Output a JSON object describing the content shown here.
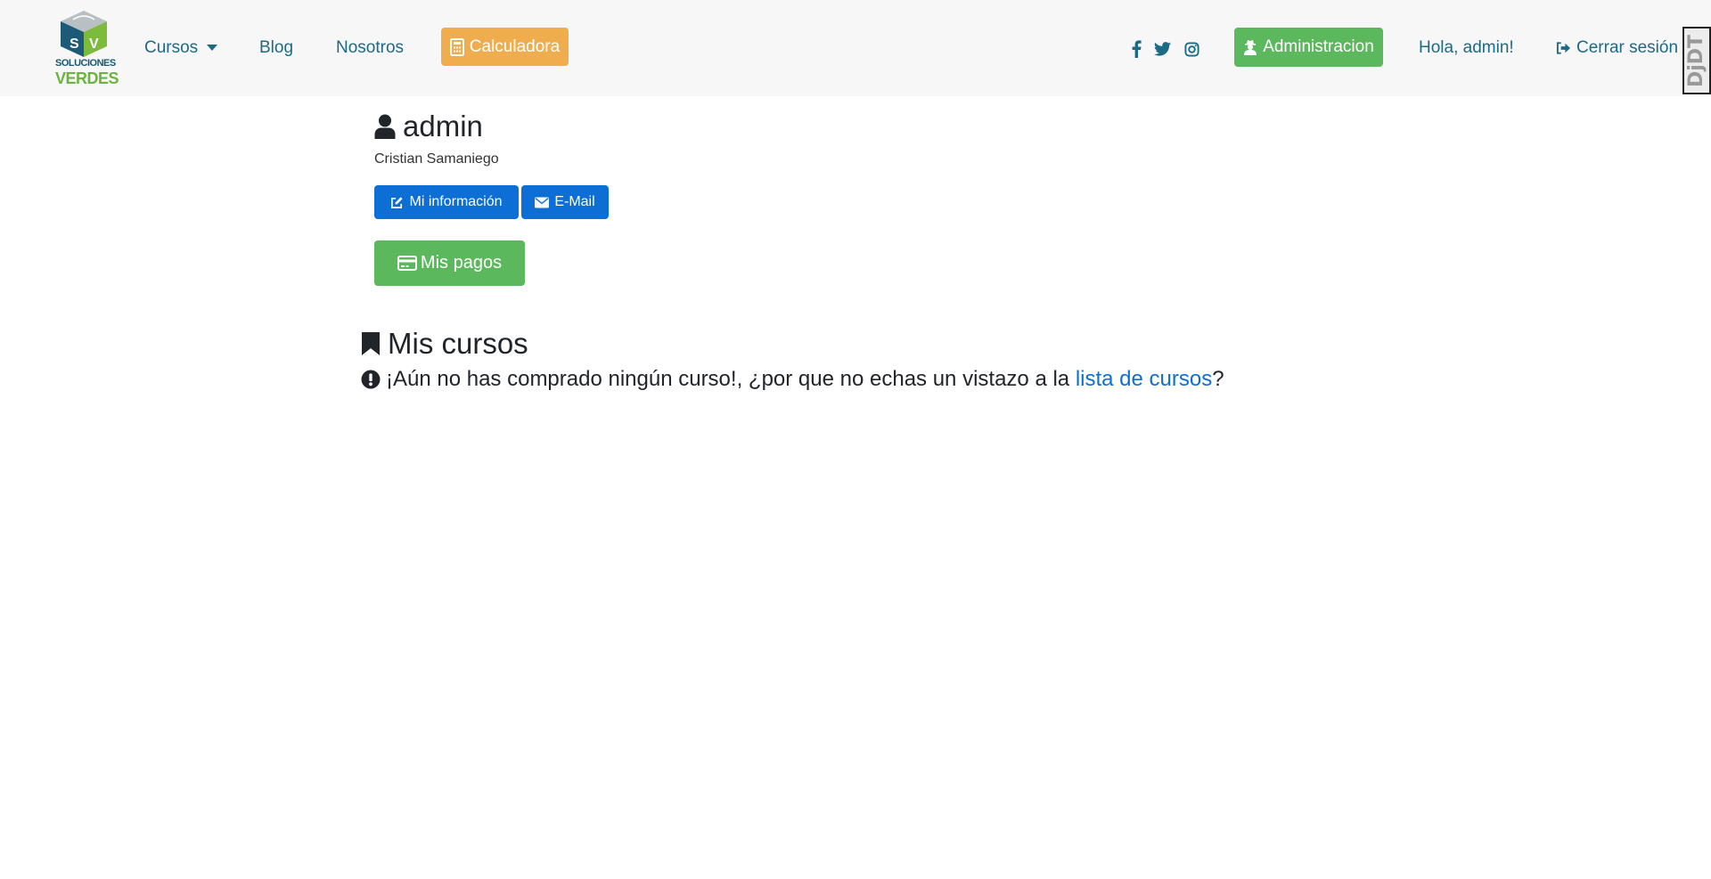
{
  "brand": {
    "logo_line1": "SOLUCIONES",
    "logo_line2": "VERDES",
    "logo_icon": "cube-logo-icon"
  },
  "nav": {
    "courses_label": "Cursos",
    "blog_label": "Blog",
    "about_label": "Nosotros",
    "calculator_label": "Calculadora",
    "admin_label": "Administracion",
    "greeting": "Hola, admin!",
    "logout_label": "Cerrar sesión",
    "social_icons": [
      "facebook-icon",
      "twitter-icon",
      "instagram-icon"
    ]
  },
  "debug_toolbar": {
    "label": "DjDT"
  },
  "profile": {
    "username": "admin",
    "full_name": "Cristian Samaniego",
    "info_button": "Mi información",
    "email_button": "E-Mail",
    "payments_button": "Mis pagos"
  },
  "courses": {
    "title": "Mis cursos",
    "empty_message": "¡Aún no has comprado ningún curso!, ¿por que no echas un vistazo a la ",
    "link_text": "lista de cursos",
    "end_text": "?"
  },
  "colors": {
    "navbar_bg": "#f7f7f7",
    "nav_link": "#1c6a86",
    "orange": "#f0ad4e",
    "green": "#5cb85c",
    "blue": "#0d6fd6"
  }
}
